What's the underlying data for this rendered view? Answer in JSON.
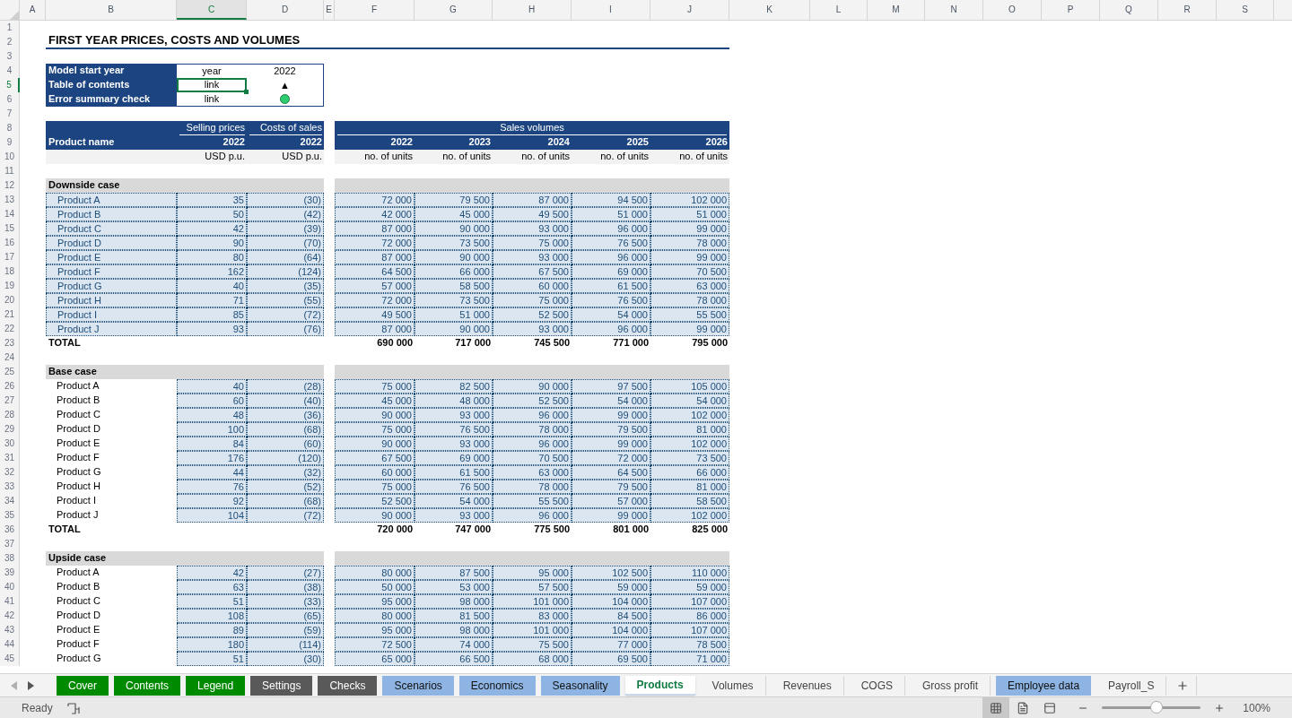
{
  "columns": [
    {
      "label": "A",
      "selected": false
    },
    {
      "label": "B",
      "selected": false
    },
    {
      "label": "C",
      "selected": true
    },
    {
      "label": "D",
      "selected": false
    },
    {
      "label": "E",
      "selected": false
    },
    {
      "label": "F",
      "selected": false
    },
    {
      "label": "G",
      "selected": false
    },
    {
      "label": "H",
      "selected": false
    },
    {
      "label": "I",
      "selected": false
    },
    {
      "label": "J",
      "selected": false
    },
    {
      "label": "K",
      "selected": false
    },
    {
      "label": "L",
      "selected": false
    },
    {
      "label": "M",
      "selected": false
    },
    {
      "label": "N",
      "selected": false
    },
    {
      "label": "O",
      "selected": false
    },
    {
      "label": "P",
      "selected": false
    },
    {
      "label": "Q",
      "selected": false
    },
    {
      "label": "R",
      "selected": false
    },
    {
      "label": "S",
      "selected": false
    }
  ],
  "row_numbers": [
    {
      "label": "1",
      "selected": false
    },
    {
      "label": "2",
      "selected": false
    },
    {
      "label": "3",
      "selected": false
    },
    {
      "label": "4",
      "selected": false
    },
    {
      "label": "5",
      "selected": true
    },
    {
      "label": "6",
      "selected": false
    },
    {
      "label": "7",
      "selected": false
    },
    {
      "label": "8",
      "selected": false
    },
    {
      "label": "9",
      "selected": false
    },
    {
      "label": "10",
      "selected": false
    },
    {
      "label": "11",
      "selected": false
    },
    {
      "label": "12",
      "selected": false
    },
    {
      "label": "13",
      "selected": false
    },
    {
      "label": "14",
      "selected": false
    },
    {
      "label": "15",
      "selected": false
    },
    {
      "label": "16",
      "selected": false
    },
    {
      "label": "17",
      "selected": false
    },
    {
      "label": "18",
      "selected": false
    },
    {
      "label": "19",
      "selected": false
    },
    {
      "label": "20",
      "selected": false
    },
    {
      "label": "21",
      "selected": false
    },
    {
      "label": "22",
      "selected": false
    },
    {
      "label": "23",
      "selected": false
    },
    {
      "label": "24",
      "selected": false
    },
    {
      "label": "25",
      "selected": false
    },
    {
      "label": "26",
      "selected": false
    },
    {
      "label": "27",
      "selected": false
    },
    {
      "label": "28",
      "selected": false
    },
    {
      "label": "29",
      "selected": false
    },
    {
      "label": "30",
      "selected": false
    },
    {
      "label": "31",
      "selected": false
    },
    {
      "label": "32",
      "selected": false
    },
    {
      "label": "33",
      "selected": false
    },
    {
      "label": "34",
      "selected": false
    },
    {
      "label": "35",
      "selected": false
    },
    {
      "label": "36",
      "selected": false
    },
    {
      "label": "37",
      "selected": false
    },
    {
      "label": "38",
      "selected": false
    },
    {
      "label": "39",
      "selected": false
    },
    {
      "label": "40",
      "selected": false
    },
    {
      "label": "41",
      "selected": false
    },
    {
      "label": "42",
      "selected": false
    },
    {
      "label": "43",
      "selected": false
    },
    {
      "label": "44",
      "selected": false
    },
    {
      "label": "45",
      "selected": false
    }
  ],
  "title": "FIRST YEAR PRICES, COSTS AND VOLUMES",
  "info_rows": [
    {
      "label": "Model start year",
      "unit": "year",
      "value": "2022",
      "kind": "text",
      "active": false
    },
    {
      "label": "Table of contents",
      "unit": "link",
      "value": "▲",
      "kind": "text",
      "active": true
    },
    {
      "label": "Error summary check",
      "unit": "link",
      "kind": "dot",
      "color": "#2ecc71",
      "active": false
    }
  ],
  "header": {
    "price_group": "Selling prices",
    "cost_group": "Costs of sales",
    "volumes_group": "Sales volumes",
    "product_name": "Product name",
    "price_year": "2022",
    "cost_year": "2022",
    "price_unit": "USD p.u.",
    "cost_unit": "USD p.u.",
    "volume_years": [
      "2022",
      "2023",
      "2024",
      "2025",
      "2026"
    ],
    "volume_units": [
      "no. of units",
      "no. of units",
      "no. of units",
      "no. of units",
      "no. of units"
    ]
  },
  "sections": [
    {
      "title": "Downside case",
      "names_highlighted": true,
      "products": [
        {
          "name": "Product A",
          "price": "35",
          "cost": "(30)",
          "volumes": [
            "72 000",
            "79 500",
            "87 000",
            "94 500",
            "102 000"
          ]
        },
        {
          "name": "Product B",
          "price": "50",
          "cost": "(42)",
          "volumes": [
            "42 000",
            "45 000",
            "49 500",
            "51 000",
            "51 000"
          ]
        },
        {
          "name": "Product C",
          "price": "42",
          "cost": "(39)",
          "volumes": [
            "87 000",
            "90 000",
            "93 000",
            "96 000",
            "99 000"
          ]
        },
        {
          "name": "Product D",
          "price": "90",
          "cost": "(70)",
          "volumes": [
            "72 000",
            "73 500",
            "75 000",
            "76 500",
            "78 000"
          ]
        },
        {
          "name": "Product E",
          "price": "80",
          "cost": "(64)",
          "volumes": [
            "87 000",
            "90 000",
            "93 000",
            "96 000",
            "99 000"
          ]
        },
        {
          "name": "Product F",
          "price": "162",
          "cost": "(124)",
          "volumes": [
            "64 500",
            "66 000",
            "67 500",
            "69 000",
            "70 500"
          ]
        },
        {
          "name": "Product G",
          "price": "40",
          "cost": "(35)",
          "volumes": [
            "57 000",
            "58 500",
            "60 000",
            "61 500",
            "63 000"
          ]
        },
        {
          "name": "Product H",
          "price": "71",
          "cost": "(55)",
          "volumes": [
            "72 000",
            "73 500",
            "75 000",
            "76 500",
            "78 000"
          ]
        },
        {
          "name": "Product I",
          "price": "85",
          "cost": "(72)",
          "volumes": [
            "49 500",
            "51 000",
            "52 500",
            "54 000",
            "55 500"
          ]
        },
        {
          "name": "Product J",
          "price": "93",
          "cost": "(76)",
          "volumes": [
            "87 000",
            "90 000",
            "93 000",
            "96 000",
            "99 000"
          ]
        }
      ],
      "total": {
        "label": "TOTAL",
        "volumes": [
          "690 000",
          "717 000",
          "745 500",
          "771 000",
          "795 000"
        ]
      }
    },
    {
      "title": "Base case",
      "names_highlighted": false,
      "products": [
        {
          "name": "Product A",
          "price": "40",
          "cost": "(28)",
          "volumes": [
            "75 000",
            "82 500",
            "90 000",
            "97 500",
            "105 000"
          ]
        },
        {
          "name": "Product B",
          "price": "60",
          "cost": "(40)",
          "volumes": [
            "45 000",
            "48 000",
            "52 500",
            "54 000",
            "54 000"
          ]
        },
        {
          "name": "Product C",
          "price": "48",
          "cost": "(36)",
          "volumes": [
            "90 000",
            "93 000",
            "96 000",
            "99 000",
            "102 000"
          ]
        },
        {
          "name": "Product D",
          "price": "100",
          "cost": "(68)",
          "volumes": [
            "75 000",
            "76 500",
            "78 000",
            "79 500",
            "81 000"
          ]
        },
        {
          "name": "Product E",
          "price": "84",
          "cost": "(60)",
          "volumes": [
            "90 000",
            "93 000",
            "96 000",
            "99 000",
            "102 000"
          ]
        },
        {
          "name": "Product F",
          "price": "176",
          "cost": "(120)",
          "volumes": [
            "67 500",
            "69 000",
            "70 500",
            "72 000",
            "73 500"
          ]
        },
        {
          "name": "Product G",
          "price": "44",
          "cost": "(32)",
          "volumes": [
            "60 000",
            "61 500",
            "63 000",
            "64 500",
            "66 000"
          ]
        },
        {
          "name": "Product H",
          "price": "76",
          "cost": "(52)",
          "volumes": [
            "75 000",
            "76 500",
            "78 000",
            "79 500",
            "81 000"
          ]
        },
        {
          "name": "Product I",
          "price": "92",
          "cost": "(68)",
          "volumes": [
            "52 500",
            "54 000",
            "55 500",
            "57 000",
            "58 500"
          ]
        },
        {
          "name": "Product J",
          "price": "104",
          "cost": "(72)",
          "volumes": [
            "90 000",
            "93 000",
            "96 000",
            "99 000",
            "102 000"
          ]
        }
      ],
      "total": {
        "label": "TOTAL",
        "volumes": [
          "720 000",
          "747 000",
          "775 500",
          "801 000",
          "825 000"
        ]
      }
    },
    {
      "title": "Upside case",
      "names_highlighted": false,
      "products": [
        {
          "name": "Product A",
          "price": "42",
          "cost": "(27)",
          "volumes": [
            "80 000",
            "87 500",
            "95 000",
            "102 500",
            "110 000"
          ]
        },
        {
          "name": "Product B",
          "price": "63",
          "cost": "(38)",
          "volumes": [
            "50 000",
            "53 000",
            "57 500",
            "59 000",
            "59 000"
          ]
        },
        {
          "name": "Product C",
          "price": "51",
          "cost": "(33)",
          "volumes": [
            "95 000",
            "98 000",
            "101 000",
            "104 000",
            "107 000"
          ]
        },
        {
          "name": "Product D",
          "price": "108",
          "cost": "(65)",
          "volumes": [
            "80 000",
            "81 500",
            "83 000",
            "84 500",
            "86 000"
          ]
        },
        {
          "name": "Product E",
          "price": "89",
          "cost": "(59)",
          "volumes": [
            "95 000",
            "98 000",
            "101 000",
            "104 000",
            "107 000"
          ]
        },
        {
          "name": "Product F",
          "price": "180",
          "cost": "(114)",
          "volumes": [
            "72 500",
            "74 000",
            "75 500",
            "77 000",
            "78 500"
          ]
        },
        {
          "name": "Product G",
          "price": "51",
          "cost": "(30)",
          "volumes": [
            "65 000",
            "66 500",
            "68 000",
            "69 500",
            "71 000"
          ]
        }
      ]
    }
  ],
  "sheet_tabs": [
    {
      "label": "Cover",
      "color": "#008a00",
      "selected": false
    },
    {
      "label": "Contents",
      "color": "#008a00",
      "selected": false
    },
    {
      "label": "Legend",
      "color": "#008a00",
      "selected": false
    },
    {
      "label": "Settings",
      "color": "#595959",
      "selected": false
    },
    {
      "label": "Checks",
      "color": "#595959",
      "selected": false
    },
    {
      "label": "Scenarios",
      "color": "#8db4e2",
      "selected": false
    },
    {
      "label": "Economics",
      "color": "#8db4e2",
      "selected": false
    },
    {
      "label": "Seasonality",
      "color": "#8db4e2",
      "selected": false
    },
    {
      "label": "Products",
      "selected": true
    },
    {
      "label": "Volumes",
      "selected": false
    },
    {
      "label": "Revenues",
      "selected": false
    },
    {
      "label": "COGS",
      "selected": false
    },
    {
      "label": "Gross profit",
      "selected": false
    },
    {
      "label": "Employee data",
      "color": "#8db4e2",
      "selected": false
    },
    {
      "label": "Payroll_S",
      "selected": false
    }
  ],
  "status_bar": {
    "status": "Ready",
    "views": [
      {
        "kind": "normal",
        "selected": true
      },
      {
        "kind": "page-layout",
        "selected": false
      },
      {
        "kind": "page-break",
        "selected": false
      }
    ],
    "zoom": {
      "level": 0.55,
      "reading": "100%"
    }
  }
}
